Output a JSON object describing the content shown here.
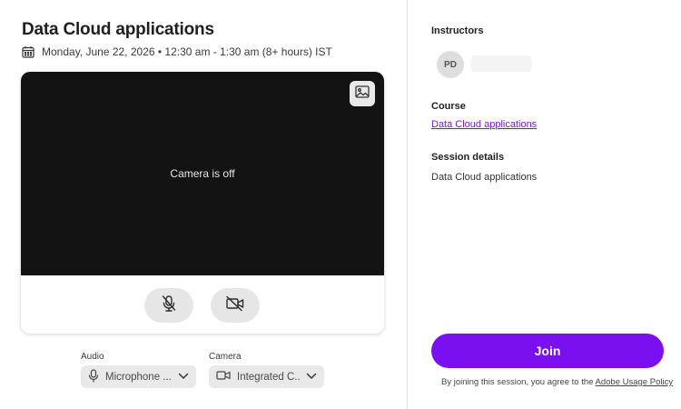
{
  "session": {
    "title": "Data Cloud applications",
    "datetime": "Monday, June 22, 2026 • 12:30 am - 1:30 am (8+ hours) IST"
  },
  "preview": {
    "camera_status": "Camera is off"
  },
  "devices": {
    "audio_label": "Audio",
    "audio_value": "Microphone ...",
    "camera_label": "Camera",
    "camera_value": "Integrated C..."
  },
  "sidebar": {
    "instructors_title": "Instructors",
    "instructor_initials": "PD",
    "course_title": "Course",
    "course_link": "Data Cloud applications",
    "session_details_title": "Session details",
    "session_details_text": "Data Cloud applications"
  },
  "join": {
    "button_label": "Join",
    "agreement_prefix": "By joining this session, you agree to the ",
    "policy_link": "Adobe Usage Policy"
  },
  "colors": {
    "accent": "#7a0ff0",
    "video_bg": "#131313",
    "link": "#6e1fcf"
  },
  "icons": [
    "calendar-icon",
    "background-image-icon",
    "mic-off-icon",
    "camera-off-icon",
    "microphone-icon",
    "video-camera-icon",
    "chevron-down-icon"
  ]
}
